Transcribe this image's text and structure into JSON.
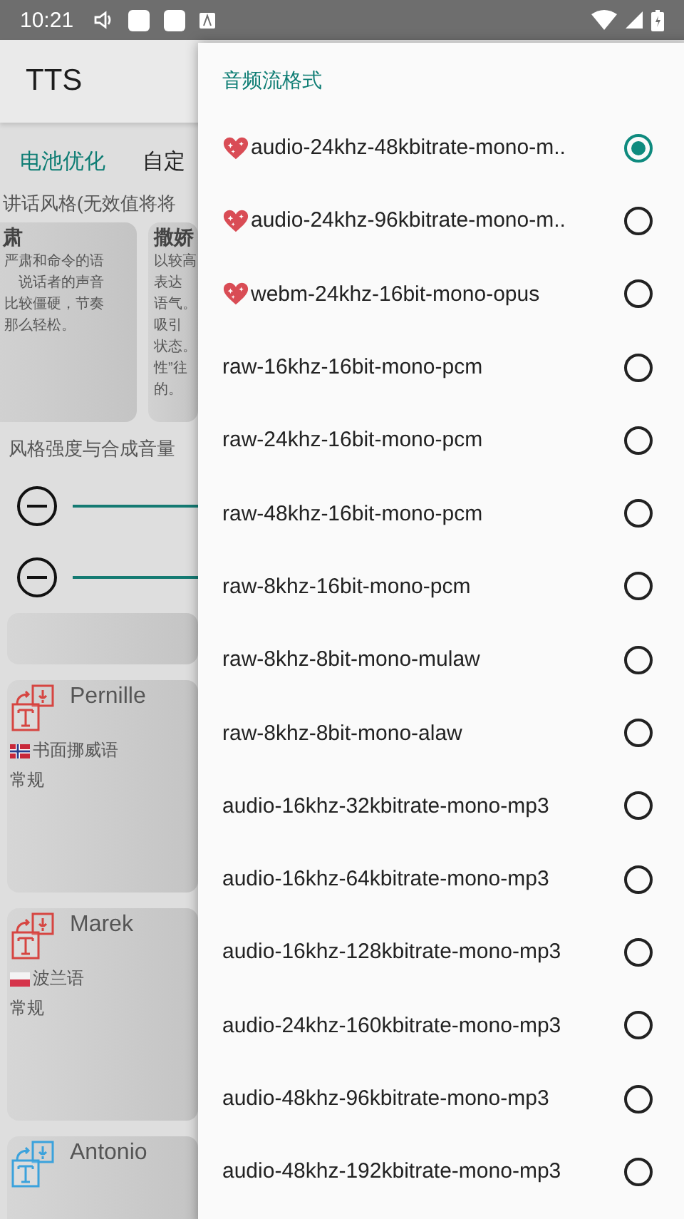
{
  "status_bar": {
    "time": "10:21"
  },
  "app_bar": {
    "title": "TTS"
  },
  "tabs": [
    {
      "label": "电池优化",
      "selected": true
    },
    {
      "label": "自定",
      "selected": false
    }
  ],
  "style_section": {
    "heading": "讲话风格(无效值将将",
    "cards": [
      {
        "title": "肃",
        "lines": [
          "严肃和命令的语",
          "说话者的声音",
          "比较僵硬，节奏",
          "那么轻松。"
        ]
      },
      {
        "title": "撒娇",
        "lines": [
          "以较高",
          "表达",
          "语气。",
          "吸引",
          "状态。",
          "性”往",
          "的。"
        ]
      }
    ]
  },
  "sliders_heading": "风格强度与合成音量",
  "sliders": [
    {
      "kind": "slider"
    },
    {
      "kind": "slider"
    }
  ],
  "voices": [
    {
      "name": "Pernille",
      "language": "书面挪威语",
      "kind": "norway",
      "style": "常规",
      "color": "#d64541"
    },
    {
      "name": "Marek",
      "language": "波兰语",
      "kind": "poland",
      "style": "常规",
      "color": "#d64541"
    },
    {
      "name": "Antonio",
      "color": "#3ba2dc"
    }
  ],
  "dialog": {
    "title": "音频流格式",
    "options": [
      {
        "label": "audio-24khz-48kbitrate-mono-m..",
        "heart": true,
        "selected": true
      },
      {
        "label": "audio-24khz-96kbitrate-mono-m..",
        "heart": true,
        "selected": false
      },
      {
        "label": "webm-24khz-16bit-mono-opus",
        "heart": true,
        "selected": false
      },
      {
        "label": "raw-16khz-16bit-mono-pcm",
        "heart": false,
        "selected": false
      },
      {
        "label": "raw-24khz-16bit-mono-pcm",
        "heart": false,
        "selected": false
      },
      {
        "label": "raw-48khz-16bit-mono-pcm",
        "heart": false,
        "selected": false
      },
      {
        "label": "raw-8khz-16bit-mono-pcm",
        "heart": false,
        "selected": false
      },
      {
        "label": "raw-8khz-8bit-mono-mulaw",
        "heart": false,
        "selected": false
      },
      {
        "label": "raw-8khz-8bit-mono-alaw",
        "heart": false,
        "selected": false
      },
      {
        "label": "audio-16khz-32kbitrate-mono-mp3",
        "heart": false,
        "selected": false
      },
      {
        "label": "audio-16khz-64kbitrate-mono-mp3",
        "heart": false,
        "selected": false
      },
      {
        "label": "audio-16khz-128kbitrate-mono-mp3",
        "heart": false,
        "selected": false
      },
      {
        "label": "audio-24khz-160kbitrate-mono-mp3",
        "heart": false,
        "selected": false
      },
      {
        "label": "audio-48khz-96kbitrate-mono-mp3",
        "heart": false,
        "selected": false
      },
      {
        "label": "audio-48khz-192kbitrate-mono-mp3",
        "heart": false,
        "selected": false
      }
    ]
  }
}
